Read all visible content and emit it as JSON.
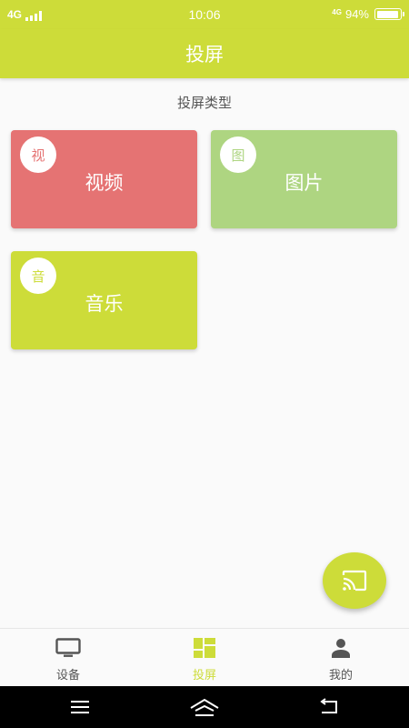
{
  "status_bar": {
    "network": "4G",
    "time": "10:06",
    "network_right": "4G",
    "battery_text": "94%",
    "battery_level": 0.94
  },
  "app_bar": {
    "title": "投屏"
  },
  "section": {
    "title": "投屏类型"
  },
  "cards": [
    {
      "badge": "视",
      "label": "视频",
      "color": "#e57373"
    },
    {
      "badge": "图",
      "label": "图片",
      "color": "#aed581"
    },
    {
      "badge": "音",
      "label": "音乐",
      "color": "#cddc39"
    }
  ],
  "fab": {
    "icon": "cast-icon"
  },
  "bottom_nav": {
    "items": [
      {
        "label": "设备",
        "icon": "tv-icon",
        "active": false
      },
      {
        "label": "投屏",
        "icon": "dashboard-icon",
        "active": true
      },
      {
        "label": "我的",
        "icon": "person-icon",
        "active": false
      }
    ]
  },
  "system_nav": {
    "icons": [
      "menu-icon",
      "home-icon",
      "back-icon"
    ]
  },
  "colors": {
    "accent": "#cddc39",
    "video": "#e57373",
    "image": "#aed581",
    "inactive": "#555555"
  }
}
